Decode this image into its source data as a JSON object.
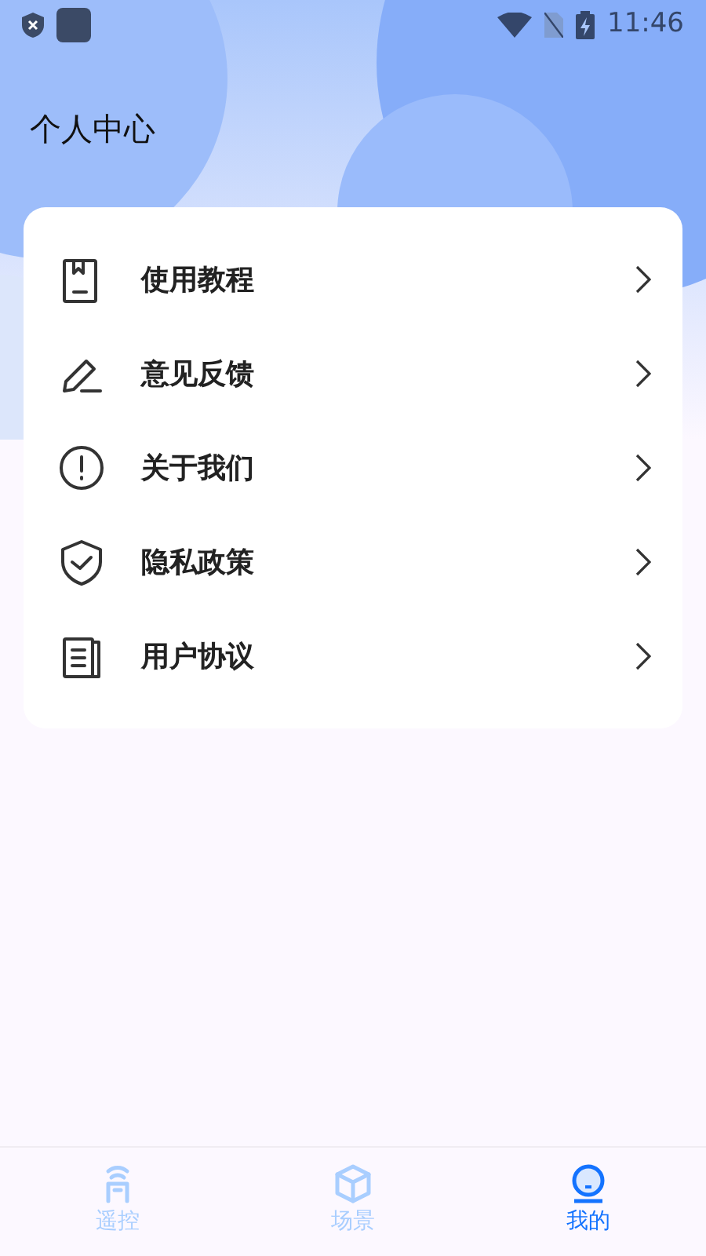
{
  "status_bar": {
    "time": "11:46"
  },
  "title": "个人中心",
  "menu": [
    {
      "label": "使用教程"
    },
    {
      "label": "意见反馈"
    },
    {
      "label": "关于我们"
    },
    {
      "label": "隐私政策"
    },
    {
      "label": "用户协议"
    }
  ],
  "tabs": [
    {
      "label": "遥控",
      "selected": false
    },
    {
      "label": "场景",
      "selected": false
    },
    {
      "label": "我的",
      "selected": true
    }
  ]
}
